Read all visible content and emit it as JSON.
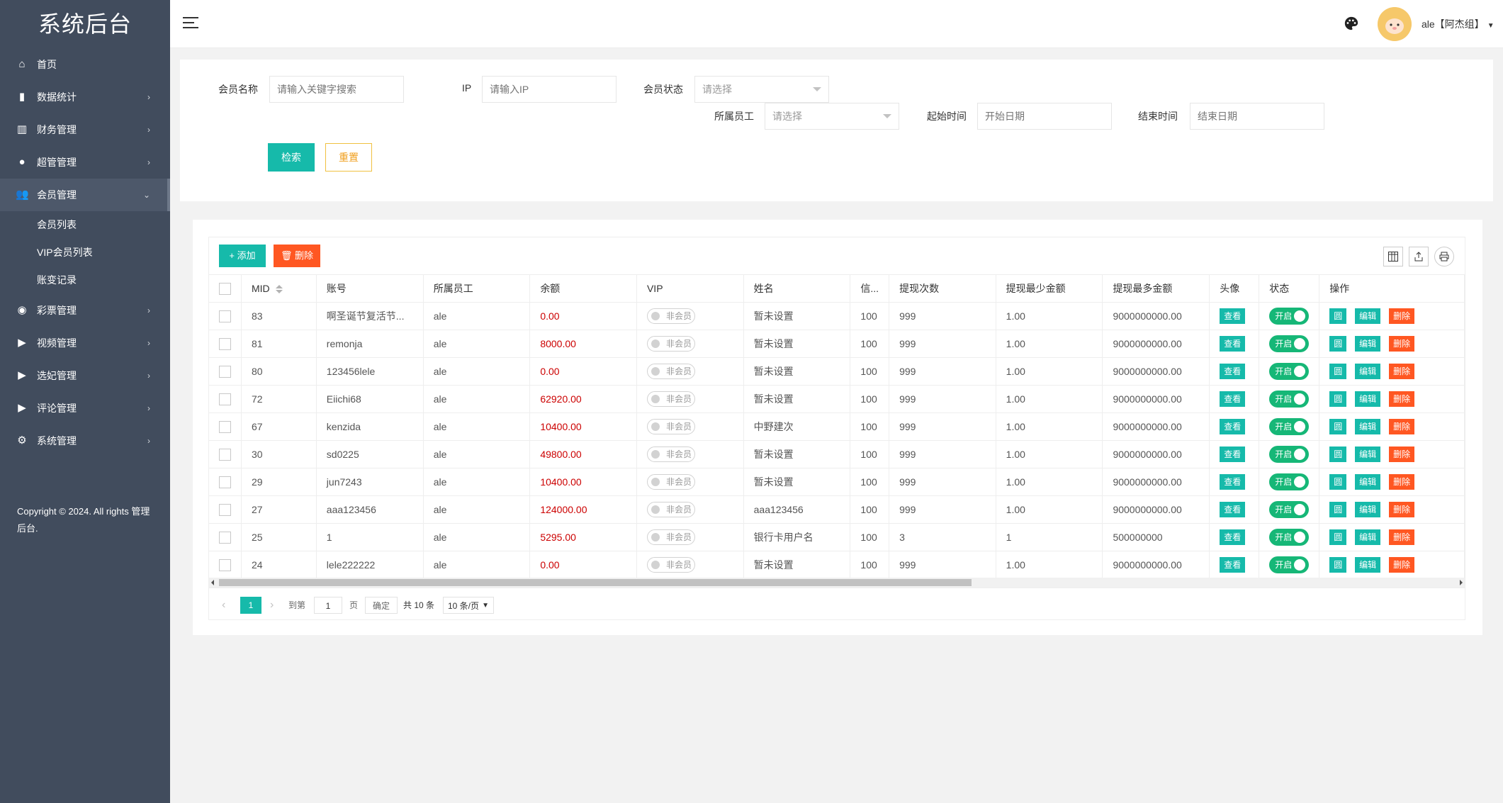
{
  "app": {
    "title": "系统后台"
  },
  "sidebar": {
    "items": [
      {
        "label": "首页",
        "icon": "home-icon",
        "glyph": "⌂"
      },
      {
        "label": "数据统计",
        "icon": "bar-chart-icon",
        "glyph": "▮"
      },
      {
        "label": "财务管理",
        "icon": "bank-icon",
        "glyph": "▥"
      },
      {
        "label": "超管管理",
        "icon": "user-icon",
        "glyph": "●"
      },
      {
        "label": "会员管理",
        "icon": "users-icon",
        "glyph": "👥"
      },
      {
        "label": "彩票管理",
        "icon": "gamepad-icon",
        "glyph": "◉"
      },
      {
        "label": "视频管理",
        "icon": "video-icon",
        "glyph": "▶"
      },
      {
        "label": "选妃管理",
        "icon": "video-icon",
        "glyph": "▶"
      },
      {
        "label": "评论管理",
        "icon": "video-icon",
        "glyph": "▶"
      },
      {
        "label": "系统管理",
        "icon": "gear-icon",
        "glyph": "⚙"
      }
    ],
    "sub_items": [
      "会员列表",
      "VIP会员列表",
      "账变记录"
    ],
    "copyright": "Copyright © 2024. All rights 管理后台."
  },
  "header": {
    "user_name": "ale【阿杰组】"
  },
  "search": {
    "member_name_label": "会员名称",
    "member_name_placeholder": "请输入关键字搜索",
    "ip_label": "IP",
    "ip_placeholder": "请输入IP",
    "status_label": "会员状态",
    "status_value": "请选择",
    "staff_label": "所属员工",
    "staff_value": "请选择",
    "start_label": "起始时间",
    "start_placeholder": "开始日期",
    "end_label": "结束时间",
    "end_placeholder": "结束日期",
    "search_button": "检索",
    "reset_button": "重置"
  },
  "toolbar": {
    "add_label": "+ 添加",
    "delete_label": "🗑 删除"
  },
  "table": {
    "columns": [
      "MID",
      "账号",
      "所属员工",
      "余额",
      "VIP",
      "姓名",
      "信...",
      "提现次数",
      "提现最少金额",
      "提现最多金额",
      "头像",
      "状态",
      "操作"
    ],
    "vip_label": "非会员",
    "view_label": "查看",
    "status_label": "开启",
    "op_icon_label": "圆",
    "edit_label": "编辑",
    "delete_label": "删除",
    "rows": [
      {
        "mid": "83",
        "account": "啊圣诞节复活节...",
        "staff": "ale",
        "balance": "0.00",
        "name": "暂未设置",
        "credit": "100",
        "count": "999",
        "min": "1.00",
        "max": "9000000000.00"
      },
      {
        "mid": "81",
        "account": "remonja",
        "staff": "ale",
        "balance": "8000.00",
        "name": "暂未设置",
        "credit": "100",
        "count": "999",
        "min": "1.00",
        "max": "9000000000.00"
      },
      {
        "mid": "80",
        "account": "123456lele",
        "staff": "ale",
        "balance": "0.00",
        "name": "暂未设置",
        "credit": "100",
        "count": "999",
        "min": "1.00",
        "max": "9000000000.00"
      },
      {
        "mid": "72",
        "account": "Eiichi68",
        "staff": "ale",
        "balance": "62920.00",
        "name": "暂未设置",
        "credit": "100",
        "count": "999",
        "min": "1.00",
        "max": "9000000000.00"
      },
      {
        "mid": "67",
        "account": "kenzida",
        "staff": "ale",
        "balance": "10400.00",
        "name": "中野建次",
        "credit": "100",
        "count": "999",
        "min": "1.00",
        "max": "9000000000.00"
      },
      {
        "mid": "30",
        "account": "sd0225",
        "staff": "ale",
        "balance": "49800.00",
        "name": "暂未设置",
        "credit": "100",
        "count": "999",
        "min": "1.00",
        "max": "9000000000.00"
      },
      {
        "mid": "29",
        "account": "jun7243",
        "staff": "ale",
        "balance": "10400.00",
        "name": "暂未设置",
        "credit": "100",
        "count": "999",
        "min": "1.00",
        "max": "9000000000.00"
      },
      {
        "mid": "27",
        "account": "aaa123456",
        "staff": "ale",
        "balance": "124000.00",
        "name": "aaa123456",
        "credit": "100",
        "count": "999",
        "min": "1.00",
        "max": "9000000000.00"
      },
      {
        "mid": "25",
        "account": "1",
        "staff": "ale",
        "balance": "5295.00",
        "name": "银行卡用户名",
        "credit": "100",
        "count": "3",
        "min": "1",
        "max": "500000000"
      },
      {
        "mid": "24",
        "account": "lele222222",
        "staff": "ale",
        "balance": "0.00",
        "name": "暂未设置",
        "credit": "100",
        "count": "999",
        "min": "1.00",
        "max": "9000000000.00"
      }
    ]
  },
  "pager": {
    "prev": "‹",
    "current": "1",
    "next": "›",
    "goto_label": "到第",
    "goto_value": "1",
    "page_label": "页",
    "confirm_label": "确定",
    "total_label": "共 10 条",
    "size_label": "10 条/页"
  },
  "colors": {
    "sidebar": "#414c5d",
    "accent": "#16baaa",
    "danger": "#ff5722",
    "switch_on": "#16b777",
    "money": "#cc0000"
  }
}
